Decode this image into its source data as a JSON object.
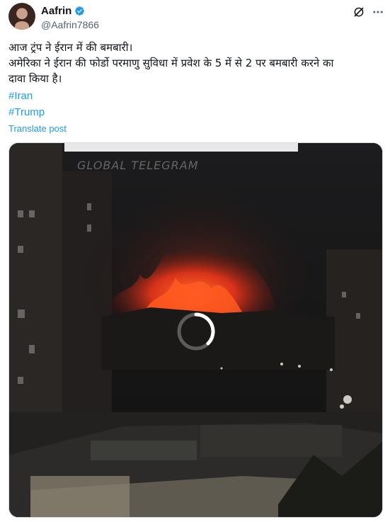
{
  "post": {
    "author_name": "Aafrin",
    "handle": "@Aafrin7866",
    "text_lines": [
      "आज ट्रंप ने ईरान में की बमबारी।",
      "अमेरिका ने ईरान की फोर्डो परमाणु सुविधा में प्रवेश के 5 में से 2 पर बमबारी करने का",
      "दावा किया है।"
    ],
    "hashtags": [
      "#Iran",
      "#Trump"
    ],
    "translate_label": "Translate post"
  },
  "media": {
    "watermark": "GLOBAL TELEGRAM"
  },
  "icons": {
    "verified": "verified-badge-icon",
    "grok": "grok-icon",
    "more": "more-options-icon",
    "loading": "loading-spinner-icon"
  },
  "colors": {
    "link": "#1d9bf0",
    "text": "#0f1419",
    "secondary": "#536471",
    "fire": "#ff4a1a"
  }
}
